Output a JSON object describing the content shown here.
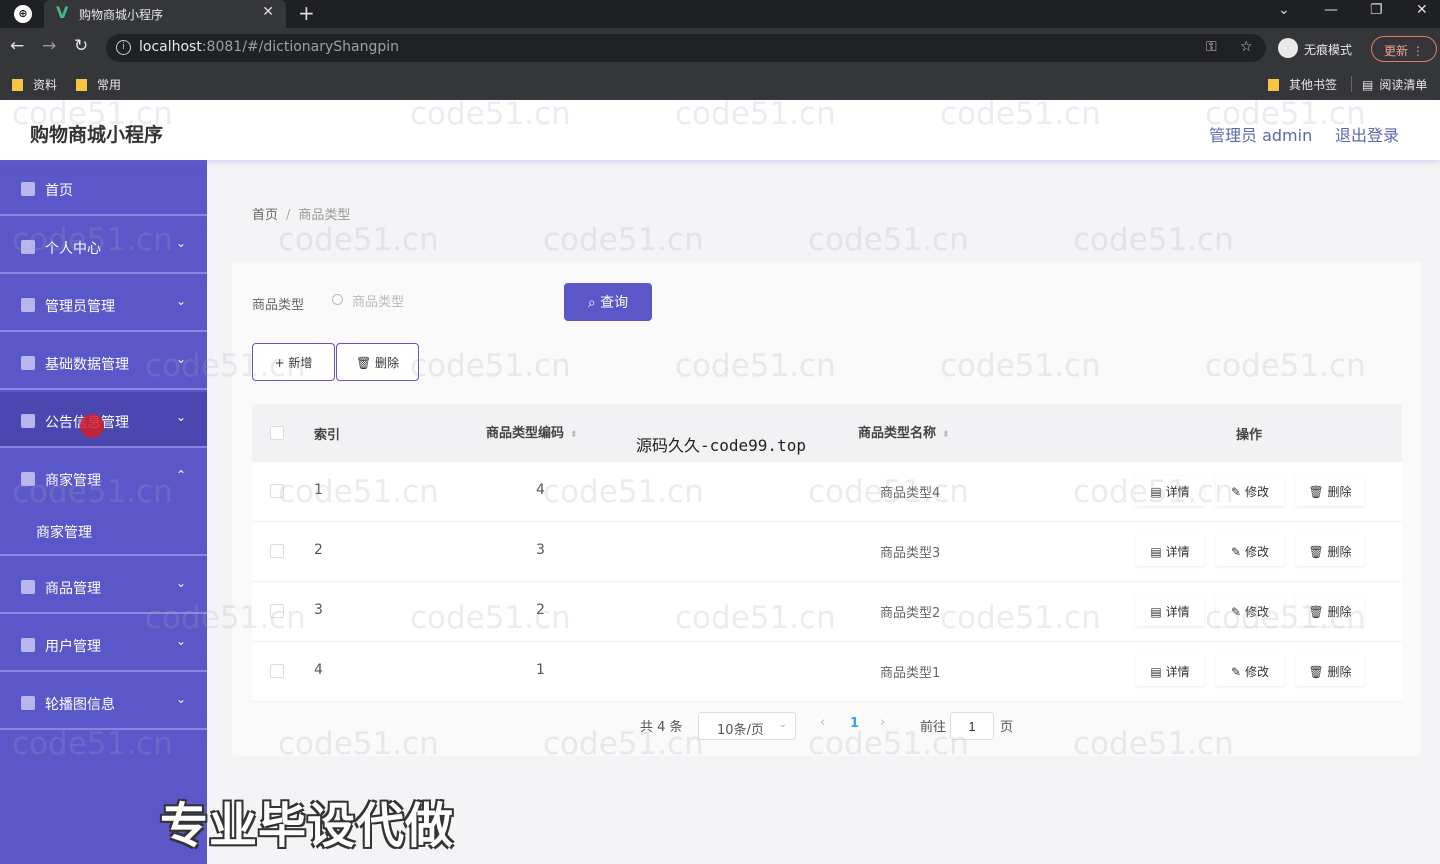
{
  "browser": {
    "tab_title": "购物商城小程序",
    "url_host": "localhost",
    "url_rest": ":8081/#/dictionaryShangpin",
    "incognito_label": "无痕模式",
    "update_label": "更新",
    "bookmarks": [
      "资料",
      "常用"
    ],
    "bookmarks_right": [
      "其他书签",
      "阅读清单"
    ]
  },
  "header": {
    "title": "购物商城小程序",
    "admin": "管理员 admin",
    "logout": "退出登录"
  },
  "sidebar": {
    "items": [
      {
        "label": "首页"
      },
      {
        "label": "个人中心"
      },
      {
        "label": "管理员管理"
      },
      {
        "label": "基础数据管理"
      },
      {
        "label": "公告信息管理"
      },
      {
        "label": "商家管理"
      },
      {
        "label": "商品管理"
      },
      {
        "label": "用户管理"
      },
      {
        "label": "轮播图信息"
      }
    ],
    "submenu": [
      "商家管理"
    ]
  },
  "breadcrumb": {
    "home": "首页",
    "current": "商品类型"
  },
  "search": {
    "label": "商品类型",
    "placeholder": "商品类型",
    "button": "查询"
  },
  "actions": {
    "add": "+ 新增",
    "delete": "删除"
  },
  "table": {
    "headers": [
      "索引",
      "商品类型编码",
      "商品类型名称",
      "操作"
    ],
    "rows": [
      {
        "index": "1",
        "code": "4",
        "name": "商品类型4"
      },
      {
        "index": "2",
        "code": "3",
        "name": "商品类型3"
      },
      {
        "index": "3",
        "code": "2",
        "name": "商品类型2"
      },
      {
        "index": "4",
        "code": "1",
        "name": "商品类型1"
      }
    ],
    "row_actions": {
      "detail": "详情",
      "edit": "修改",
      "delete": "删除"
    }
  },
  "pagination": {
    "total": "共 4 条",
    "page_size": "10条/页",
    "current_page": "1",
    "goto_label": "前往",
    "goto_value": "1",
    "unit": "页"
  },
  "overlays": {
    "watermark": "code51.cn",
    "code99": "源码久久-code99.top",
    "promo": "专业毕设代做"
  },
  "colors": {
    "sidebar": "#5a57c9",
    "accent": "#5a57c9",
    "active_page": "#409eff"
  }
}
